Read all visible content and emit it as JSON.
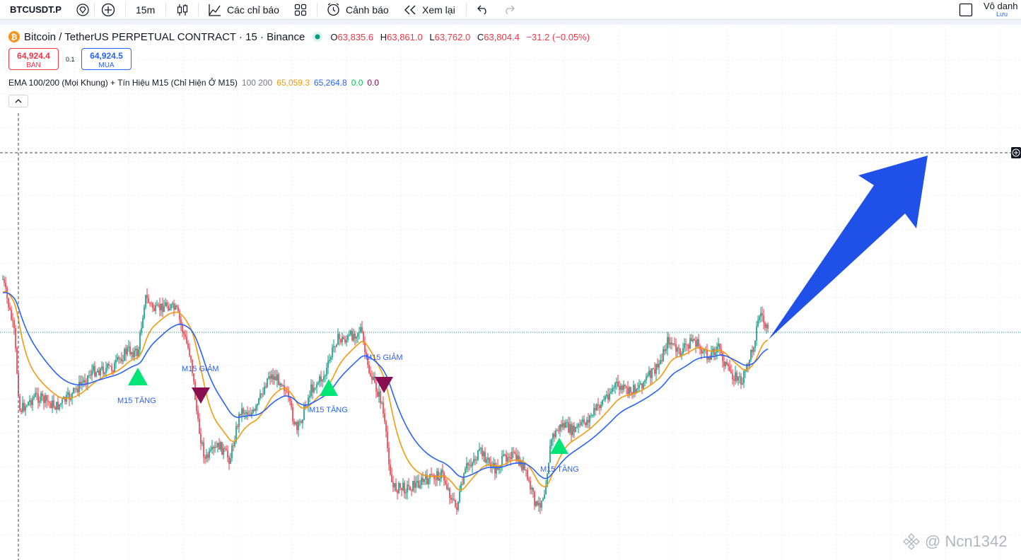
{
  "toolbar": {
    "symbol": "BTCUSDT.P",
    "interval": "15m",
    "indicators_label": "Các chỉ báo",
    "alerts_label": "Cảnh báo",
    "replay_label": "Xem lại",
    "user_name": "Vô danh",
    "user_sub": "Lưu"
  },
  "legend": {
    "title": "Bitcoin / TetherUS PERPETUAL CONTRACT · 15 · Binance",
    "o_label": "O",
    "o": "63,835.6",
    "h_label": "H",
    "h": "63,861.0",
    "l_label": "L",
    "l": "63,762.0",
    "c_label": "C",
    "c": "63,804.4",
    "change": "−31.2 (−0.05%)"
  },
  "trade": {
    "sell_price": "64,924.4",
    "sell_label": "BÁN",
    "spread": "0.1",
    "buy_price": "64,924.5",
    "buy_label": "MUA"
  },
  "indicator": {
    "name": "EMA 100/200 (Mọi Khung) + Tín Hiệu M15 (Chỉ Hiện Ở M15)",
    "params": "100 200",
    "v1": "65,059.3",
    "v2": "65,264.8",
    "v3": "0.0",
    "v4": "0.0"
  },
  "signals": {
    "up1": "M15 TĂNG",
    "down1": "M15 GIẢM",
    "up2": "M15 TĂNG",
    "down2": "M15 GIẢM",
    "up3": "M15 TĂNG"
  },
  "watermark": "@ Ncn1342",
  "colors": {
    "ema_fast": "#f59a0c",
    "ema_slow": "#2962ff",
    "up_candle": "#089981",
    "down_candle": "#f23645",
    "buy_signal": "#00e676",
    "sell_signal": "#880e4f",
    "arrow": "#1f50e8"
  }
}
